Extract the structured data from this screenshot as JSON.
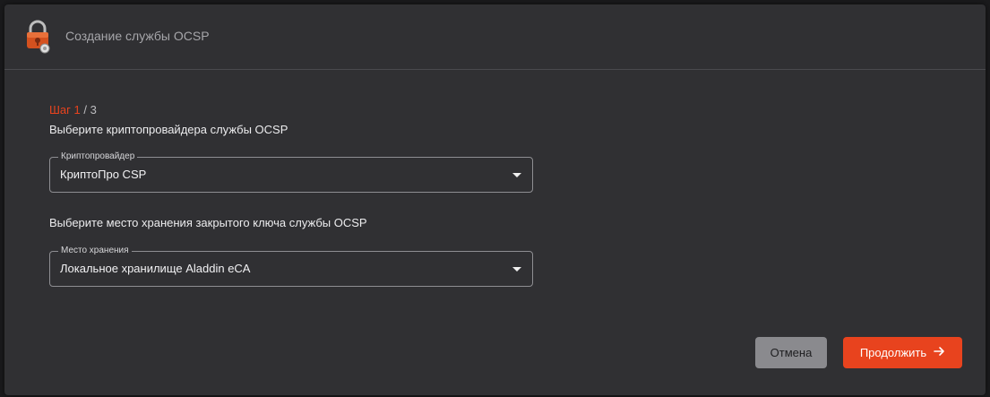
{
  "dialog": {
    "title": "Создание службы OCSP",
    "logo_icon": "lock-shield-logo-icon"
  },
  "step": {
    "prefix": "Шаг",
    "current": "1",
    "separator": "/",
    "total": "3"
  },
  "crypto_provider": {
    "heading": "Выберите криптопровайдера службы OCSP",
    "field_label": "Криптопровайдер",
    "value": "КриптоПро CSP"
  },
  "key_storage": {
    "heading": "Выберите место хранения закрытого ключа службы OCSP",
    "field_label": "Место хранения",
    "value": "Локальное хранилище Aladdin eCA"
  },
  "actions": {
    "cancel_label": "Отмена",
    "continue_label": "Продолжить",
    "continue_icon": "arrow-right-icon"
  },
  "colors": {
    "accent": "#e8431e",
    "dialog_bg": "#303033",
    "cancel_bg": "#8a8a8e"
  }
}
